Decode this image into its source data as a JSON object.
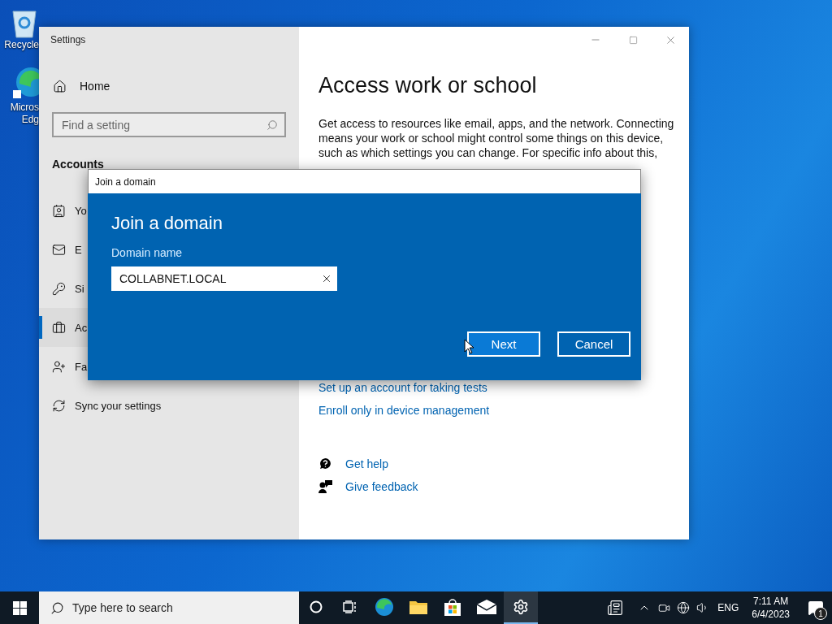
{
  "desktop_icons": [
    {
      "kind": "recycle",
      "lines": [
        "Recycle"
      ]
    },
    {
      "kind": "edge",
      "lines": [
        "Micros",
        "Edg"
      ]
    }
  ],
  "settings_window": {
    "title": "Settings",
    "sidebar": {
      "home": "Home",
      "search_placeholder": "Find a setting",
      "section": "Accounts",
      "items": [
        {
          "kind": "info",
          "label": "Yo",
          "selected": false
        },
        {
          "kind": "email",
          "label": "E",
          "selected": false
        },
        {
          "kind": "key",
          "label": "Si",
          "selected": false
        },
        {
          "kind": "briefcase",
          "label": "Ac",
          "selected": true
        },
        {
          "kind": "family",
          "label": "Fa",
          "selected": false
        },
        {
          "kind": "sync",
          "label": "Sync your settings",
          "selected": false
        }
      ]
    },
    "page": {
      "title": "Access work or school",
      "description": "Get access to resources like email, apps, and the network. Connecting means your work or school might control some things on this device, such as which settings you can change. For specific info about this,",
      "links": [
        "Set up an account for taking tests",
        "Enroll only in device management"
      ],
      "help_links": [
        {
          "kind": "help",
          "label": "Get help"
        },
        {
          "kind": "feedback",
          "label": "Give feedback"
        }
      ]
    }
  },
  "dialog": {
    "title": "Join a domain",
    "heading": "Join a domain",
    "field_label": "Domain name",
    "field_value": "COLLABNET.LOCAL",
    "buttons": [
      {
        "kind": "primary",
        "label": "Next"
      },
      {
        "kind": "secondary",
        "label": "Cancel"
      }
    ]
  },
  "taskbar": {
    "search_placeholder": "Type here to search",
    "apps": [
      {
        "kind": "cortana",
        "selected": false
      },
      {
        "kind": "taskview",
        "selected": false
      },
      {
        "kind": "edge",
        "selected": false
      },
      {
        "kind": "explorer",
        "selected": false
      },
      {
        "kind": "store",
        "selected": false
      },
      {
        "kind": "mail",
        "selected": false
      },
      {
        "kind": "settings",
        "selected": true
      }
    ],
    "language": "ENG",
    "time": "7:11 AM",
    "date": "6/4/2023",
    "notification_count": "1"
  }
}
